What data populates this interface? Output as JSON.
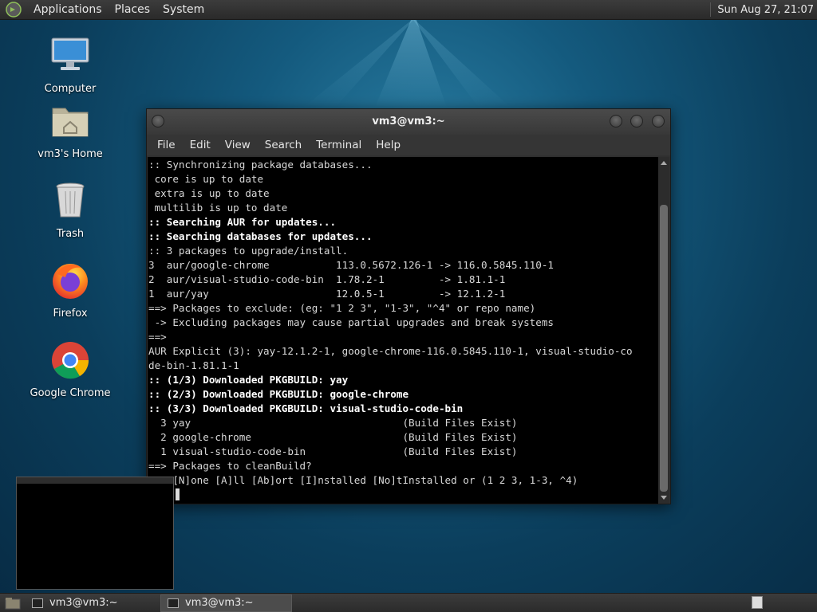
{
  "top_panel": {
    "menus": [
      "Applications",
      "Places",
      "System"
    ],
    "clock": "Sun Aug 27, 21:07"
  },
  "desktop_icons": [
    {
      "label": "Computer",
      "icon": "computer-icon"
    },
    {
      "label": "vm3's Home",
      "icon": "home-folder-icon"
    },
    {
      "label": "Trash",
      "icon": "trash-icon"
    },
    {
      "label": "Firefox",
      "icon": "firefox-icon"
    },
    {
      "label": "Google Chrome",
      "icon": "chrome-icon"
    }
  ],
  "terminal": {
    "title": "vm3@vm3:~",
    "menu": [
      "File",
      "Edit",
      "View",
      "Search",
      "Terminal",
      "Help"
    ],
    "lines": [
      {
        "text": ":: Synchronizing package databases...",
        "bold": false
      },
      {
        "text": " core is up to date",
        "bold": false
      },
      {
        "text": " extra is up to date",
        "bold": false
      },
      {
        "text": " multilib is up to date",
        "bold": false
      },
      {
        "text": ":: Searching AUR for updates...",
        "bold": true
      },
      {
        "text": ":: Searching databases for updates...",
        "bold": true
      },
      {
        "text": ":: 3 packages to upgrade/install.",
        "bold": false
      },
      {
        "text": "3  aur/google-chrome           113.0.5672.126-1 -> 116.0.5845.110-1",
        "bold": false
      },
      {
        "text": "2  aur/visual-studio-code-bin  1.78.2-1         -> 1.81.1-1",
        "bold": false
      },
      {
        "text": "1  aur/yay                     12.0.5-1         -> 12.1.2-1",
        "bold": false
      },
      {
        "text": "==> Packages to exclude: (eg: \"1 2 3\", \"1-3\", \"^4\" or repo name)",
        "bold": false
      },
      {
        "text": " -> Excluding packages may cause partial upgrades and break systems",
        "bold": false
      },
      {
        "text": "==>",
        "bold": false
      },
      {
        "text": "AUR Explicit (3): yay-12.1.2-1, google-chrome-116.0.5845.110-1, visual-studio-co",
        "bold": false
      },
      {
        "text": "de-bin-1.81.1-1",
        "bold": false
      },
      {
        "text": ":: (1/3) Downloaded PKGBUILD: yay",
        "bold": true
      },
      {
        "text": ":: (2/3) Downloaded PKGBUILD: google-chrome",
        "bold": true
      },
      {
        "text": ":: (3/3) Downloaded PKGBUILD: visual-studio-code-bin",
        "bold": true
      },
      {
        "text": "  3 yay                                   (Build Files Exist)",
        "bold": false
      },
      {
        "text": "  2 google-chrome                         (Build Files Exist)",
        "bold": false
      },
      {
        "text": "  1 visual-studio-code-bin                (Build Files Exist)",
        "bold": false
      },
      {
        "text": "==> Packages to cleanBuild?",
        "bold": false
      },
      {
        "text": "==> [N]one [A]ll [Ab]ort [I]nstalled [No]tInstalled or (1 2 3, 1-3, ^4)",
        "bold": false
      }
    ]
  },
  "taskbar": {
    "tasks": [
      {
        "label": "vm3@vm3:~",
        "active": false
      },
      {
        "label": "vm3@vm3:~",
        "active": true
      }
    ]
  },
  "colors": {
    "panel": "#2f2f2f",
    "terminal_bg": "#000000",
    "desktop_accent": "#1f6f97"
  }
}
